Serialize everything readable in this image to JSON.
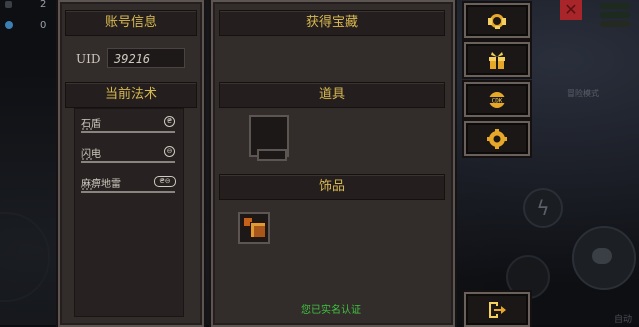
{
  "hud": {
    "top_count_1": "2",
    "top_count_2": "0",
    "bottom_right_label": "自动",
    "mode_label": "冒险模式"
  },
  "account": {
    "header": "账号信息",
    "uid_label": "UID",
    "uid_value": "39216"
  },
  "spells": {
    "header": "当前法术",
    "items": [
      {
        "name": "石盾",
        "icons": "₴"
      },
      {
        "name": "闪电",
        "icons": "⊖"
      },
      {
        "name": "麻痹地雷",
        "icons": "₴⊖"
      }
    ]
  },
  "treasure": {
    "header": "获得宝藏",
    "props_header": "道具",
    "ornaments_header": "饰品",
    "verified_text": "您已实名认证"
  },
  "side_buttons": [
    {
      "name": "customer-service",
      "icon": "headset-icon"
    },
    {
      "name": "gift",
      "icon": "gift-icon"
    },
    {
      "name": "cdk",
      "icon": "cdk-badge-icon"
    },
    {
      "name": "settings",
      "icon": "gear-icon"
    },
    {
      "name": "exit",
      "icon": "exit-icon"
    }
  ],
  "colors": {
    "header_text": "#d8b850",
    "panel_bg": "#322c2a",
    "verified_text": "#3fc43f",
    "button_icon": "#e7a82a"
  }
}
